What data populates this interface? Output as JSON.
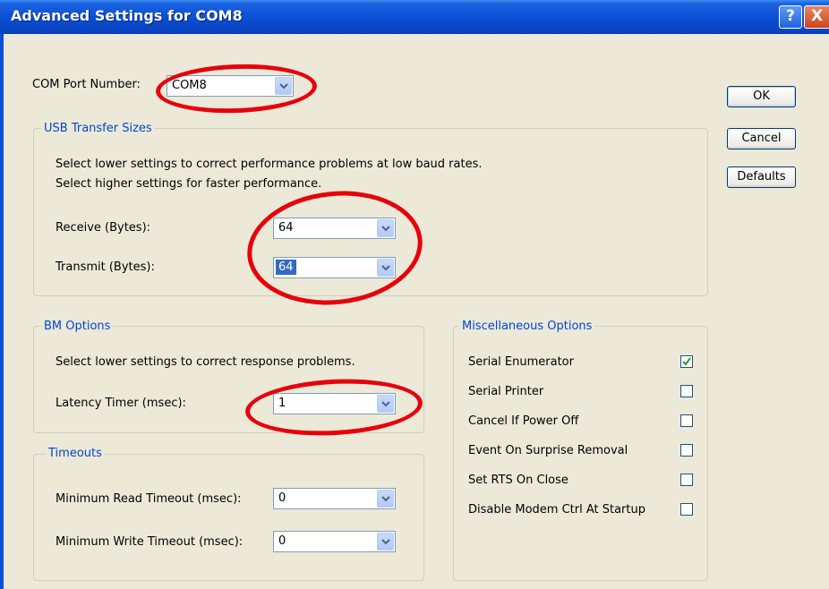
{
  "window": {
    "title": "Advanced Settings for COM8",
    "help_glyph": "?",
    "close_glyph": "X"
  },
  "com_port": {
    "label": "COM Port Number:",
    "value": "COM8"
  },
  "buttons": {
    "ok": "OK",
    "cancel": "Cancel",
    "defaults": "Defaults"
  },
  "usb": {
    "legend": "USB Transfer Sizes",
    "line1": "Select lower settings to correct performance problems at low baud rates.",
    "line2": "Select higher settings for faster performance.",
    "receive_label": "Receive (Bytes):",
    "receive_value": "64",
    "transmit_label": "Transmit (Bytes):",
    "transmit_value": "64"
  },
  "bm": {
    "legend": "BM Options",
    "desc": "Select lower settings to correct response problems.",
    "latency_label": "Latency Timer (msec):",
    "latency_value": "1"
  },
  "timeouts": {
    "legend": "Timeouts",
    "read_label": "Minimum Read Timeout (msec):",
    "read_value": "0",
    "write_label": "Minimum Write Timeout (msec):",
    "write_value": "0"
  },
  "misc": {
    "legend": "Miscellaneous Options",
    "options": [
      {
        "label": "Serial Enumerator",
        "checked": true
      },
      {
        "label": "Serial Printer",
        "checked": false
      },
      {
        "label": "Cancel If Power Off",
        "checked": false
      },
      {
        "label": "Event On Surprise Removal",
        "checked": false
      },
      {
        "label": "Set RTS On Close",
        "checked": false
      },
      {
        "label": "Disable Modem Ctrl At Startup",
        "checked": false
      }
    ]
  },
  "colors": {
    "title_bar": "#0a4fd6",
    "dialog_bg": "#ece9d8",
    "annotation_red": "#e8000a",
    "legend_blue": "#0046d5"
  }
}
